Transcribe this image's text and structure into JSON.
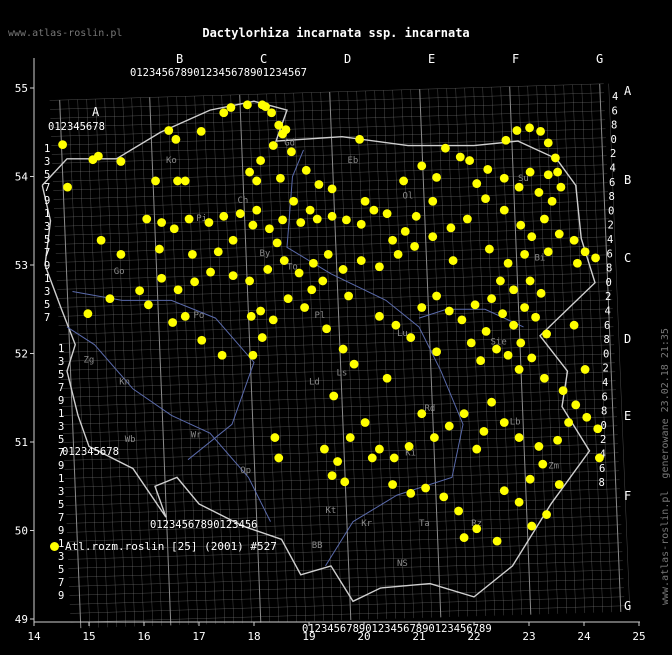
{
  "title": "Dactylorhiza incarnata ssp. incarnata",
  "site_label": "www.atlas-roslin.pl",
  "footer": {
    "url": "www.atlas-roslin.pl",
    "generated": "generowane 23.02.18 21:35"
  },
  "legend": {
    "label": "Atl.rozm.roslin [25] (2001) #527",
    "color": "#ffff00"
  },
  "colors": {
    "background": "#000000",
    "grid": "#8a8a8a",
    "border": "#cfcfcf",
    "rivers": "#5a6aaa",
    "points": "#ffff00",
    "text": "#ffffff"
  },
  "map": {
    "x_ticks": [
      "14",
      "15",
      "16",
      "17",
      "18",
      "19",
      "20",
      "21",
      "22",
      "23",
      "24",
      "25"
    ],
    "y_ticks": [
      "55",
      "54",
      "53",
      "52",
      "51",
      "50",
      "49"
    ],
    "grid_column_letters": [
      "A",
      "B",
      "C",
      "D",
      "E",
      "F",
      "G"
    ],
    "grid_row_letters": [
      "A",
      "B",
      "C",
      "D",
      "E",
      "F",
      "G"
    ],
    "region_labels": [
      "Gd",
      "Ko",
      "Eb",
      "Ch",
      "Ol",
      "Pi",
      "By",
      "Su",
      "Bi",
      "Go",
      "Zg",
      "Po",
      "To",
      "Lu",
      "Pl",
      "Ls",
      "Kn",
      "Sie",
      "Ld",
      "Wr",
      "Wb",
      "Op",
      "Rd",
      "Ki",
      "Lb",
      "Zm",
      "Kt",
      "Kr",
      "Ta",
      "Rz",
      "NS",
      "BB"
    ],
    "points": [
      {
        "lon": 14.52,
        "lat": 54.36
      },
      {
        "lon": 14.61,
        "lat": 53.88
      },
      {
        "lon": 15.07,
        "lat": 54.19
      },
      {
        "lon": 15.17,
        "lat": 54.23
      },
      {
        "lon": 15.58,
        "lat": 54.17
      },
      {
        "lon": 16.45,
        "lat": 54.52
      },
      {
        "lon": 16.58,
        "lat": 54.42
      },
      {
        "lon": 17.04,
        "lat": 54.51
      },
      {
        "lon": 17.45,
        "lat": 54.72
      },
      {
        "lon": 17.58,
        "lat": 54.78
      },
      {
        "lon": 17.88,
        "lat": 54.81
      },
      {
        "lon": 18.15,
        "lat": 54.81
      },
      {
        "lon": 18.21,
        "lat": 54.79
      },
      {
        "lon": 18.32,
        "lat": 54.72
      },
      {
        "lon": 18.45,
        "lat": 54.58
      },
      {
        "lon": 18.52,
        "lat": 54.48
      },
      {
        "lon": 18.58,
        "lat": 54.53
      },
      {
        "lon": 18.35,
        "lat": 54.35
      },
      {
        "lon": 18.68,
        "lat": 54.28
      },
      {
        "lon": 18.12,
        "lat": 54.18
      },
      {
        "lon": 17.92,
        "lat": 54.05
      },
      {
        "lon": 18.05,
        "lat": 53.95
      },
      {
        "lon": 18.48,
        "lat": 53.98
      },
      {
        "lon": 18.95,
        "lat": 54.07
      },
      {
        "lon": 19.18,
        "lat": 53.91
      },
      {
        "lon": 19.42,
        "lat": 53.86
      },
      {
        "lon": 19.92,
        "lat": 54.42
      },
      {
        "lon": 16.21,
        "lat": 53.95
      },
      {
        "lon": 16.61,
        "lat": 53.95
      },
      {
        "lon": 16.75,
        "lat": 53.95
      },
      {
        "lon": 16.05,
        "lat": 53.52
      },
      {
        "lon": 16.32,
        "lat": 53.48
      },
      {
        "lon": 16.55,
        "lat": 53.41
      },
      {
        "lon": 16.82,
        "lat": 53.52
      },
      {
        "lon": 17.18,
        "lat": 53.48
      },
      {
        "lon": 17.45,
        "lat": 53.55
      },
      {
        "lon": 17.75,
        "lat": 53.58
      },
      {
        "lon": 17.98,
        "lat": 53.45
      },
      {
        "lon": 18.28,
        "lat": 53.41
      },
      {
        "lon": 18.52,
        "lat": 53.51
      },
      {
        "lon": 18.85,
        "lat": 53.48
      },
      {
        "lon": 19.15,
        "lat": 53.52
      },
      {
        "lon": 19.42,
        "lat": 53.55
      },
      {
        "lon": 19.68,
        "lat": 53.51
      },
      {
        "lon": 19.95,
        "lat": 53.46
      },
      {
        "lon": 20.18,
        "lat": 53.62
      },
      {
        "lon": 20.42,
        "lat": 53.58
      },
      {
        "lon": 20.72,
        "lat": 53.95
      },
      {
        "lon": 21.05,
        "lat": 54.12
      },
      {
        "lon": 21.32,
        "lat": 53.99
      },
      {
        "lon": 21.48,
        "lat": 54.32
      },
      {
        "lon": 21.75,
        "lat": 54.22
      },
      {
        "lon": 21.92,
        "lat": 54.18
      },
      {
        "lon": 22.25,
        "lat": 54.08
      },
      {
        "lon": 22.55,
        "lat": 53.98
      },
      {
        "lon": 22.58,
        "lat": 54.41
      },
      {
        "lon": 22.78,
        "lat": 54.52
      },
      {
        "lon": 23.01,
        "lat": 54.55
      },
      {
        "lon": 23.21,
        "lat": 54.51
      },
      {
        "lon": 23.35,
        "lat": 54.38
      },
      {
        "lon": 23.48,
        "lat": 54.21
      },
      {
        "lon": 23.52,
        "lat": 54.05
      },
      {
        "lon": 23.58,
        "lat": 53.88
      },
      {
        "lon": 23.42,
        "lat": 53.72
      },
      {
        "lon": 23.28,
        "lat": 53.52
      },
      {
        "lon": 23.55,
        "lat": 53.35
      },
      {
        "lon": 23.82,
        "lat": 53.28
      },
      {
        "lon": 24.02,
        "lat": 53.15
      },
      {
        "lon": 24.21,
        "lat": 53.08
      },
      {
        "lon": 23.88,
        "lat": 53.02
      },
      {
        "lon": 23.35,
        "lat": 53.15
      },
      {
        "lon": 23.05,
        "lat": 53.32
      },
      {
        "lon": 22.85,
        "lat": 53.45
      },
      {
        "lon": 22.55,
        "lat": 53.62
      },
      {
        "lon": 22.21,
        "lat": 53.75
      },
      {
        "lon": 21.88,
        "lat": 53.52
      },
      {
        "lon": 21.58,
        "lat": 53.42
      },
      {
        "lon": 21.25,
        "lat": 53.32
      },
      {
        "lon": 20.92,
        "lat": 53.21
      },
      {
        "lon": 20.62,
        "lat": 53.12
      },
      {
        "lon": 20.28,
        "lat": 52.98
      },
      {
        "lon": 19.95,
        "lat": 53.05
      },
      {
        "lon": 19.62,
        "lat": 52.95
      },
      {
        "lon": 19.35,
        "lat": 53.12
      },
      {
        "lon": 19.08,
        "lat": 53.02
      },
      {
        "lon": 18.82,
        "lat": 52.91
      },
      {
        "lon": 18.55,
        "lat": 53.05
      },
      {
        "lon": 18.25,
        "lat": 52.95
      },
      {
        "lon": 17.92,
        "lat": 52.82
      },
      {
        "lon": 17.62,
        "lat": 52.88
      },
      {
        "lon": 17.21,
        "lat": 52.92
      },
      {
        "lon": 16.92,
        "lat": 52.81
      },
      {
        "lon": 16.62,
        "lat": 52.72
      },
      {
        "lon": 16.32,
        "lat": 52.85
      },
      {
        "lon": 15.92,
        "lat": 52.71
      },
      {
        "lon": 15.58,
        "lat": 53.12
      },
      {
        "lon": 15.22,
        "lat": 53.28
      },
      {
        "lon": 14.98,
        "lat": 52.45
      },
      {
        "lon": 15.38,
        "lat": 52.62
      },
      {
        "lon": 16.08,
        "lat": 52.55
      },
      {
        "lon": 16.52,
        "lat": 52.35
      },
      {
        "lon": 17.05,
        "lat": 52.15
      },
      {
        "lon": 17.42,
        "lat": 51.98
      },
      {
        "lon": 17.95,
        "lat": 52.42
      },
      {
        "lon": 18.35,
        "lat": 52.38
      },
      {
        "lon": 18.92,
        "lat": 52.52
      },
      {
        "lon": 19.32,
        "lat": 52.28
      },
      {
        "lon": 19.62,
        "lat": 52.05
      },
      {
        "lon": 19.82,
        "lat": 51.88
      },
      {
        "lon": 20.28,
        "lat": 52.42
      },
      {
        "lon": 20.58,
        "lat": 52.32
      },
      {
        "lon": 20.85,
        "lat": 52.18
      },
      {
        "lon": 21.05,
        "lat": 52.52
      },
      {
        "lon": 21.32,
        "lat": 52.65
      },
      {
        "lon": 21.55,
        "lat": 52.48
      },
      {
        "lon": 21.78,
        "lat": 52.38
      },
      {
        "lon": 22.02,
        "lat": 52.55
      },
      {
        "lon": 22.32,
        "lat": 52.62
      },
      {
        "lon": 22.52,
        "lat": 52.45
      },
      {
        "lon": 22.72,
        "lat": 52.32
      },
      {
        "lon": 22.92,
        "lat": 52.52
      },
      {
        "lon": 23.12,
        "lat": 52.41
      },
      {
        "lon": 23.32,
        "lat": 52.22
      },
      {
        "lon": 22.85,
        "lat": 52.12
      },
      {
        "lon": 22.62,
        "lat": 51.98
      },
      {
        "lon": 22.41,
        "lat": 52.05
      },
      {
        "lon": 22.12,
        "lat": 51.92
      },
      {
        "lon": 22.82,
        "lat": 51.82
      },
      {
        "lon": 23.05,
        "lat": 51.95
      },
      {
        "lon": 23.28,
        "lat": 51.72
      },
      {
        "lon": 23.62,
        "lat": 51.58
      },
      {
        "lon": 23.85,
        "lat": 51.42
      },
      {
        "lon": 24.05,
        "lat": 51.28
      },
      {
        "lon": 24.25,
        "lat": 51.15
      },
      {
        "lon": 24.28,
        "lat": 50.82
      },
      {
        "lon": 23.52,
        "lat": 51.02
      },
      {
        "lon": 23.18,
        "lat": 50.95
      },
      {
        "lon": 22.82,
        "lat": 51.05
      },
      {
        "lon": 22.55,
        "lat": 51.22
      },
      {
        "lon": 22.32,
        "lat": 51.45
      },
      {
        "lon": 22.18,
        "lat": 51.12
      },
      {
        "lon": 22.05,
        "lat": 50.92
      },
      {
        "lon": 21.82,
        "lat": 51.32
      },
      {
        "lon": 21.55,
        "lat": 51.18
      },
      {
        "lon": 21.28,
        "lat": 51.05
      },
      {
        "lon": 21.05,
        "lat": 51.32
      },
      {
        "lon": 20.82,
        "lat": 50.95
      },
      {
        "lon": 20.55,
        "lat": 50.82
      },
      {
        "lon": 20.28,
        "lat": 50.92
      },
      {
        "lon": 20.02,
        "lat": 51.22
      },
      {
        "lon": 19.75,
        "lat": 51.05
      },
      {
        "lon": 19.52,
        "lat": 50.78
      },
      {
        "lon": 19.28,
        "lat": 50.92
      },
      {
        "lon": 19.42,
        "lat": 50.62
      },
      {
        "lon": 19.65,
        "lat": 50.55
      },
      {
        "lon": 20.15,
        "lat": 50.82
      },
      {
        "lon": 20.52,
        "lat": 50.52
      },
      {
        "lon": 20.85,
        "lat": 50.42
      },
      {
        "lon": 21.12,
        "lat": 50.48
      },
      {
        "lon": 21.45,
        "lat": 50.38
      },
      {
        "lon": 21.72,
        "lat": 50.22
      },
      {
        "lon": 22.05,
        "lat": 50.02
      },
      {
        "lon": 22.55,
        "lat": 50.45
      },
      {
        "lon": 22.82,
        "lat": 50.32
      },
      {
        "lon": 23.02,
        "lat": 50.58
      },
      {
        "lon": 23.25,
        "lat": 50.75
      },
      {
        "lon": 23.55,
        "lat": 50.52
      },
      {
        "lon": 23.32,
        "lat": 50.18
      },
      {
        "lon": 23.05,
        "lat": 50.05
      },
      {
        "lon": 22.42,
        "lat": 49.88
      },
      {
        "lon": 21.82,
        "lat": 49.92
      },
      {
        "lon": 18.45,
        "lat": 50.82
      },
      {
        "lon": 18.38,
        "lat": 51.05
      },
      {
        "lon": 17.98,
        "lat": 51.98
      },
      {
        "lon": 18.12,
        "lat": 52.48
      },
      {
        "lon": 18.62,
        "lat": 52.62
      },
      {
        "lon": 19.05,
        "lat": 52.72
      },
      {
        "lon": 19.25,
        "lat": 52.82
      },
      {
        "lon": 19.72,
        "lat": 52.65
      },
      {
        "lon": 18.42,
        "lat": 53.25
      },
      {
        "lon": 18.72,
        "lat": 53.72
      },
      {
        "lon": 19.02,
        "lat": 53.62
      },
      {
        "lon": 17.35,
        "lat": 53.15
      },
      {
        "lon": 17.62,
        "lat": 53.28
      },
      {
        "lon": 16.88,
        "lat": 53.12
      },
      {
        "lon": 18.05,
        "lat": 53.62
      },
      {
        "lon": 20.02,
        "lat": 53.72
      },
      {
        "lon": 20.75,
        "lat": 53.38
      },
      {
        "lon": 21.62,
        "lat": 53.05
      },
      {
        "lon": 22.28,
        "lat": 53.18
      },
      {
        "lon": 22.62,
        "lat": 53.02
      },
      {
        "lon": 22.92,
        "lat": 53.12
      },
      {
        "lon": 23.18,
        "lat": 53.82
      },
      {
        "lon": 23.02,
        "lat": 54.05
      },
      {
        "lon": 22.82,
        "lat": 53.88
      },
      {
        "lon": 23.35,
        "lat": 54.02
      },
      {
        "lon": 22.05,
        "lat": 53.92
      },
      {
        "lon": 21.25,
        "lat": 53.72
      },
      {
        "lon": 20.95,
        "lat": 53.55
      },
      {
        "lon": 20.52,
        "lat": 53.28
      },
      {
        "lon": 22.48,
        "lat": 52.82
      },
      {
        "lon": 22.72,
        "lat": 52.72
      },
      {
        "lon": 23.02,
        "lat": 52.82
      },
      {
        "lon": 23.22,
        "lat": 52.68
      },
      {
        "lon": 22.22,
        "lat": 52.25
      },
      {
        "lon": 21.95,
        "lat": 52.12
      },
      {
        "lon": 23.82,
        "lat": 52.32
      },
      {
        "lon": 24.02,
        "lat": 51.82
      },
      {
        "lon": 23.72,
        "lat": 51.22
      },
      {
        "lon": 21.32,
        "lat": 52.02
      },
      {
        "lon": 20.42,
        "lat": 51.72
      },
      {
        "lon": 19.45,
        "lat": 51.52
      },
      {
        "lon": 18.15,
        "lat": 52.18
      },
      {
        "lon": 16.75,
        "lat": 52.42
      },
      {
        "lon": 16.28,
        "lat": 53.18
      }
    ]
  }
}
